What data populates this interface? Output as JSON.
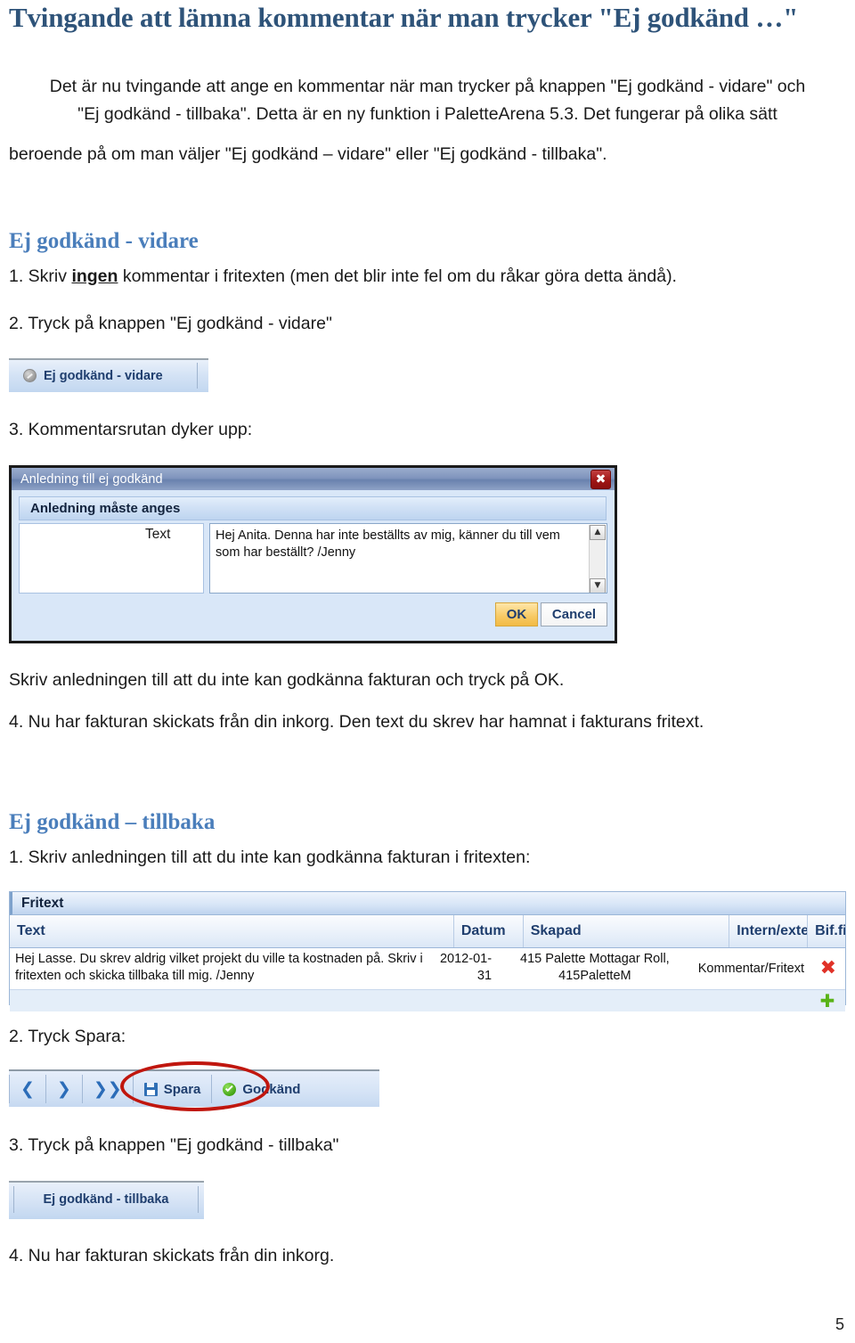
{
  "document": {
    "title": "Tvingande att lämna kommentar när man trycker \"Ej godkänd …\"",
    "intro_line1": "Det är nu tvingande att ange en kommentar när man trycker på knappen \"Ej godkänd - vidare\" och",
    "intro_line2": "\"Ej godkänd - tillbaka\". Detta är en ny funktion i PaletteArena 5.3. Det fungerar på olika sätt",
    "intro_line3": "beroende på om man väljer \"Ej godkänd – vidare\" eller \"Ej godkänd - tillbaka\".",
    "page_number": "5"
  },
  "section_vidare": {
    "heading": "Ej godkänd - vidare",
    "step1_pre": "1. Skriv ",
    "step1_bold": "ingen",
    "step1_post": " kommentar i fritexten (men det blir inte fel om du råkar göra detta ändå).",
    "step2": "2. Tryck på knappen \"Ej godkänd - vidare\"",
    "step3": "3. Kommentarsrutan dyker upp:",
    "after_dialog": "Skriv anledningen till att du inte kan godkänna fakturan och tryck på OK.",
    "step4": "4. Nu har fakturan skickats från din inkorg. Den text du skrev har hamnat i fakturans fritext."
  },
  "button_vidare": {
    "label": "Ej godkänd - vidare",
    "icon": "deny-circle-icon"
  },
  "dialog": {
    "title": "Anledning till ej godkänd",
    "close_label": "✖",
    "section_title": "Anledning måste anges",
    "text_label": "Text",
    "text_value": "Hej Anita. Denna har inte beställts av mig, känner du till vem som har beställt? /Jenny",
    "scroll_up": "▲",
    "scroll_down": "▼",
    "ok_label": "OK",
    "cancel_label": "Cancel"
  },
  "section_tillbaka": {
    "heading": "Ej godkänd – tillbaka",
    "step1": "1. Skriv anledningen till att du inte kan godkänna fakturan i fritexten:",
    "step2": "2. Tryck Spara:",
    "step3": "3. Tryck på knappen \"Ej godkänd - tillbaka\"",
    "step4": "4. Nu har fakturan skickats från din inkorg."
  },
  "fritext_table": {
    "panel_title": "Fritext",
    "columns": [
      "Text",
      "Datum",
      "Skapad",
      "Intern/extern",
      "Bif.fil"
    ],
    "rows": [
      {
        "text": "Hej Lasse. Du skrev aldrig vilket projekt du ville ta kostnaden på. Skriv i fritexten och skicka tillbaka till mig. /Jenny",
        "datum": "2012-01-31",
        "skapad": "415 Palette Mottagar Roll, 415PaletteM",
        "intern_extern": "Kommentar/Fritext",
        "bif_fil": "",
        "delete_icon": "delete-x-icon"
      }
    ],
    "add_icon": "add-plus-icon"
  },
  "toolbar": {
    "items": [
      {
        "name": "prev",
        "glyph": "❮",
        "label": ""
      },
      {
        "name": "next",
        "glyph": "❯",
        "label": ""
      },
      {
        "name": "last",
        "glyph": "❯❯",
        "label": ""
      },
      {
        "name": "save",
        "glyph": "",
        "label": "Spara"
      },
      {
        "name": "approve",
        "glyph": "",
        "label": "Godkänd"
      }
    ],
    "save_label": "Spara",
    "approve_label": "Godkänd"
  },
  "button_tillbaka": {
    "label": "Ej godkänd - tillbaka"
  },
  "colors": {
    "title_blue": "#2E5379",
    "heading_blue": "#4A7EBB",
    "ui_label_blue": "#1F3E6E",
    "ok_button": "#F2BB44",
    "delete_red": "#E03127",
    "add_green": "#59B318",
    "highlight_ellipse": "#C0160E"
  }
}
